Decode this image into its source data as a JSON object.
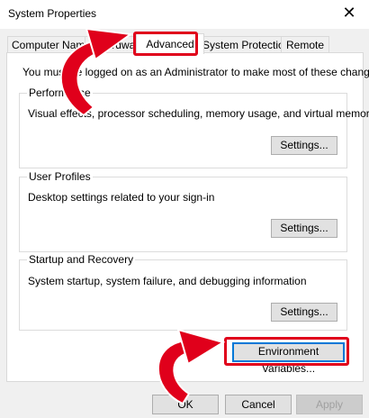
{
  "window": {
    "title": "System Properties",
    "close_glyph": "✕"
  },
  "tabs": [
    {
      "label": "Computer Name",
      "active": false
    },
    {
      "label": "Hardware",
      "active": false
    },
    {
      "label": "Advanced",
      "active": true
    },
    {
      "label": "System Protection",
      "active": false
    },
    {
      "label": "Remote",
      "active": false
    }
  ],
  "advanced": {
    "intro": "You must be logged on as an Administrator to make most of these changes.",
    "performance": {
      "legend": "Performance",
      "description": "Visual effects, processor scheduling, memory usage, and virtual memory",
      "button": "Settings..."
    },
    "user_profiles": {
      "legend": "User Profiles",
      "description": "Desktop settings related to your sign-in",
      "button": "Settings..."
    },
    "startup_recovery": {
      "legend": "Startup and Recovery",
      "description": "System startup, system failure, and debugging information",
      "button": "Settings..."
    },
    "env_button": "Environment Variables..."
  },
  "footer": {
    "ok": "OK",
    "cancel": "Cancel",
    "apply": "Apply"
  },
  "annotations": {
    "highlight_color": "#e0001b",
    "arrow_color": "#e0001b"
  }
}
